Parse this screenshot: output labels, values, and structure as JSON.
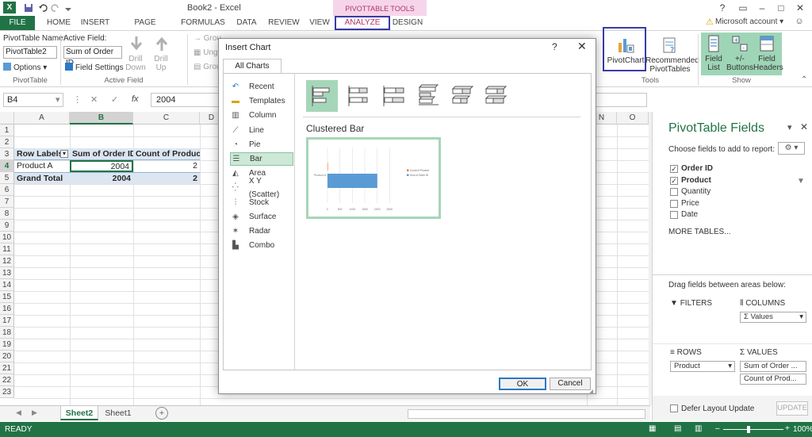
{
  "window": {
    "title": "Book2 - Excel",
    "context_tab_label": "PIVOTTABLE TOOLS",
    "account": "Microsoft account",
    "account_arrow": "▾",
    "help": "?",
    "minimize": "–",
    "restore": "□",
    "close": "✕",
    "logo": "X"
  },
  "quick_access": {
    "save_icon": "save-icon",
    "undo_icon": "undo-icon",
    "redo_icon": "redo-icon",
    "customize_icon": "customize-icon"
  },
  "tabs": [
    {
      "label": "FILE"
    },
    {
      "label": "HOME"
    },
    {
      "label": "INSERT"
    },
    {
      "label": "PAGE LAYOUT"
    },
    {
      "label": "FORMULAS"
    },
    {
      "label": "DATA"
    },
    {
      "label": "REVIEW"
    },
    {
      "label": "VIEW"
    },
    {
      "label": "ANALYZE"
    },
    {
      "label": "DESIGN"
    }
  ],
  "ribbon": {
    "pivottable_name_label": "PivotTable Name:",
    "pivottable_name_value": "PivotTable2",
    "options_label": "Options",
    "pivottable_group": "PivotTable",
    "active_field_label": "Active Field:",
    "active_field_value": "Sum of Order ID",
    "field_settings_label": "Field Settings",
    "drill_down": "Drill Down",
    "drill_up": "Drill Up",
    "active_field_group": "Active Field",
    "group_partial_1": "Grou",
    "group_partial_2": "Ungr",
    "group_partial_3": "Grou",
    "pivotchart_label": "PivotChart",
    "recommended_line1": "Recommended",
    "recommended_line2": "PivotTables",
    "tools_group": "Tools",
    "field_list_line1": "Field",
    "field_list_line2": "List",
    "buttons_line1": "+/-",
    "buttons_line2": "Buttons",
    "headers_line1": "Field",
    "headers_line2": "Headers",
    "show_group": "Show"
  },
  "formula_bar": {
    "namebox": "B4",
    "value": "2004",
    "fx": "fx",
    "cancel": "✕",
    "enter": "✓"
  },
  "grid": {
    "columns": [
      "A",
      "B",
      "C",
      "D",
      "N",
      "O"
    ],
    "rows": [
      "1",
      "2",
      "3",
      "4",
      "5",
      "6",
      "7",
      "8",
      "9",
      "10",
      "11",
      "12",
      "13",
      "14",
      "15",
      "16",
      "17",
      "18",
      "19",
      "20",
      "21",
      "22",
      "23"
    ],
    "pivot": {
      "header": [
        "Row Labels",
        "Sum of Order ID",
        "Count of Product"
      ],
      "filter_icon": "▾",
      "row": [
        "Product A",
        "2004",
        "2"
      ],
      "total": [
        "Grand Total",
        "2004",
        "2"
      ]
    }
  },
  "sheets": {
    "active": "Sheet2",
    "other": "Sheet1",
    "add": "+"
  },
  "status": {
    "text": "READY",
    "zoom": "100%",
    "minus": "–",
    "plus": "+"
  },
  "pane": {
    "title": "PivotTable Fields",
    "close": "✕",
    "choose": "Choose fields to add to report:",
    "fields": [
      {
        "name": "Order ID",
        "checked": true
      },
      {
        "name": "Product",
        "checked": true
      },
      {
        "name": "Quantity",
        "checked": false
      },
      {
        "name": "Price",
        "checked": false
      },
      {
        "name": "Date",
        "checked": false
      }
    ],
    "more_tables": "MORE TABLES...",
    "drag_text": "Drag fields between areas below:",
    "filters": "FILTERS",
    "columns": "COLUMNS",
    "columns_item": "Σ Values",
    "rows": "ROWS",
    "rows_item": "Product",
    "values": "Σ VALUES",
    "values_item_1": "Sum of Order ...",
    "values_item_2": "Count of Prod...",
    "defer": "Defer Layout Update",
    "update": "UPDATE",
    "check": "✓"
  },
  "dialog": {
    "title": "Insert Chart",
    "help": "?",
    "close": "✕",
    "tab": "All Charts",
    "chart_types": [
      {
        "label": "Recent",
        "icon": "recent-icon"
      },
      {
        "label": "Templates",
        "icon": "folder-icon"
      },
      {
        "label": "Column",
        "icon": "column-chart-icon"
      },
      {
        "label": "Line",
        "icon": "line-chart-icon"
      },
      {
        "label": "Pie",
        "icon": "pie-chart-icon"
      },
      {
        "label": "Bar",
        "icon": "bar-chart-icon"
      },
      {
        "label": "Area",
        "icon": "area-chart-icon"
      },
      {
        "label": "X Y (Scatter)",
        "icon": "scatter-chart-icon"
      },
      {
        "label": "Stock",
        "icon": "stock-chart-icon"
      },
      {
        "label": "Surface",
        "icon": "surface-chart-icon"
      },
      {
        "label": "Radar",
        "icon": "radar-chart-icon"
      },
      {
        "label": "Combo",
        "icon": "combo-chart-icon"
      }
    ],
    "selected_type": "Bar",
    "subtype_title": "Clustered Bar",
    "ok": "OK",
    "cancel": "Cancel"
  },
  "chart_data": {
    "type": "bar",
    "categories": [
      "Product A"
    ],
    "series": [
      {
        "name": "Count of Product",
        "values": [
          2
        ],
        "color": "#ed7d31"
      },
      {
        "name": "Sum of Order ID",
        "values": [
          2004
        ],
        "color": "#5b9bd5"
      }
    ],
    "xlim": [
      0,
      3000
    ],
    "xticks": [
      "0",
      "500",
      "1000",
      "1500",
      "2000",
      "2500"
    ],
    "legend": "right"
  },
  "colors": {
    "excel_green": "#217346",
    "analyze_pink": "#b3326e",
    "highlight_blue": "#3a3aa8",
    "bar_blue": "#5b9bd5",
    "bar_orange": "#ed7d31"
  }
}
